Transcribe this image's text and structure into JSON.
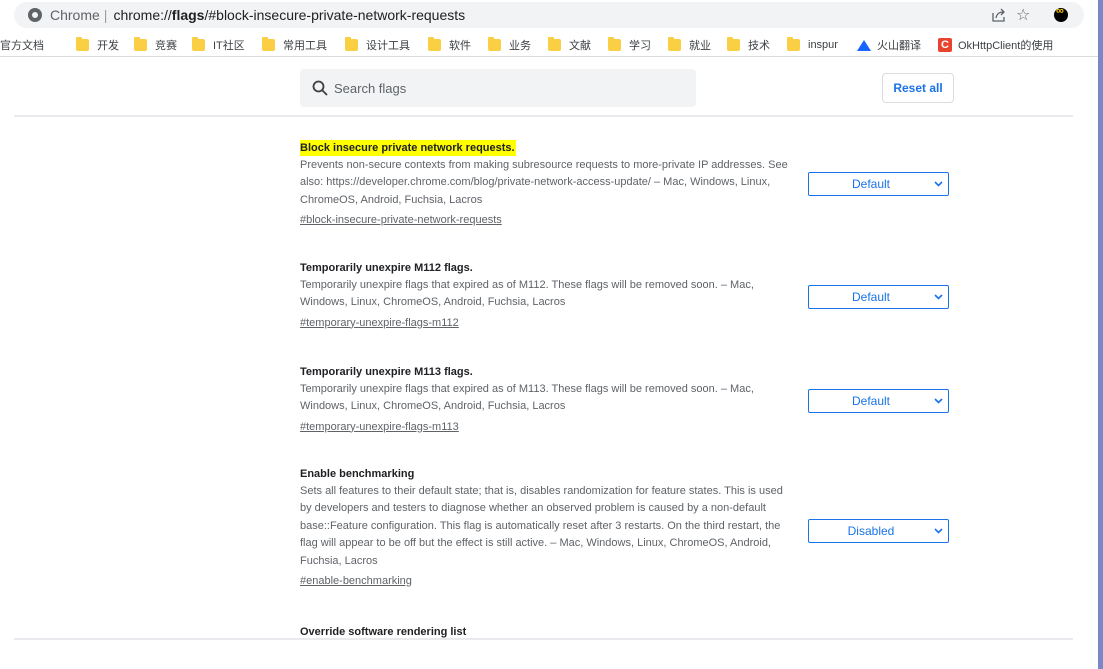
{
  "omnibox": {
    "chip": "Chrome",
    "separator": "|",
    "url_prefix": "chrome://",
    "url_bold": "flags",
    "url_suffix": "/#block-insecure-private-network-requests"
  },
  "toolbar_icons": [
    "share-icon",
    "star-icon",
    "extension-icon"
  ],
  "bookmarks": [
    {
      "label": "官方文档",
      "icon": "none"
    },
    {
      "label": "开发",
      "icon": "folder-icon"
    },
    {
      "label": "竞赛",
      "icon": "folder-icon"
    },
    {
      "label": "IT社区",
      "icon": "folder-icon"
    },
    {
      "label": "常用工具",
      "icon": "folder-icon"
    },
    {
      "label": "设计工具",
      "icon": "folder-icon"
    },
    {
      "label": "软件",
      "icon": "folder-icon"
    },
    {
      "label": "业务",
      "icon": "folder-icon"
    },
    {
      "label": "文献",
      "icon": "folder-icon"
    },
    {
      "label": "学习",
      "icon": "folder-icon"
    },
    {
      "label": "就业",
      "icon": "folder-icon"
    },
    {
      "label": "技术",
      "icon": "folder-icon"
    },
    {
      "label": "inspur",
      "icon": "folder-icon"
    },
    {
      "label": "火山翻译",
      "icon": "volcano-icon"
    },
    {
      "label": "OkHttpClient的使用",
      "icon": "c-icon"
    }
  ],
  "search": {
    "placeholder": "Search flags",
    "value": ""
  },
  "reset_label": "Reset all",
  "flags": [
    {
      "title": "Block insecure private network requests.",
      "description": "Prevents non-secure contexts from making subresource requests to more-private IP addresses. See also: https://developer.chrome.com/blog/private-network-access-update/ – Mac, Windows, Linux, ChromeOS, Android, Fuchsia, Lacros",
      "link": "#block-insecure-private-network-requests",
      "value": "Default"
    },
    {
      "title": "Temporarily unexpire M112 flags.",
      "description": "Temporarily unexpire flags that expired as of M112. These flags will be removed soon. – Mac, Windows, Linux, ChromeOS, Android, Fuchsia, Lacros",
      "link": "#temporary-unexpire-flags-m112",
      "value": "Default"
    },
    {
      "title": "Temporarily unexpire M113 flags.",
      "description": "Temporarily unexpire flags that expired as of M113. These flags will be removed soon. – Mac, Windows, Linux, ChromeOS, Android, Fuchsia, Lacros",
      "link": "#temporary-unexpire-flags-m113",
      "value": "Default"
    },
    {
      "title": "Enable benchmarking",
      "description": "Sets all features to their default state; that is, disables randomization for feature states. This is used by developers and testers to diagnose whether an observed problem is caused by a non-default base::Feature configuration. This flag is automatically reset after 3 restarts. On the third restart, the flag will appear to be off but the effect is still active. – Mac, Windows, Linux, ChromeOS, Android, Fuchsia, Lacros",
      "link": "#enable-benchmarking",
      "value": "Disabled"
    },
    {
      "title": "Override software rendering list"
    }
  ],
  "colors": {
    "accent": "#1a73e8",
    "highlight": "#ffff00",
    "folder": "#fbcf44"
  }
}
